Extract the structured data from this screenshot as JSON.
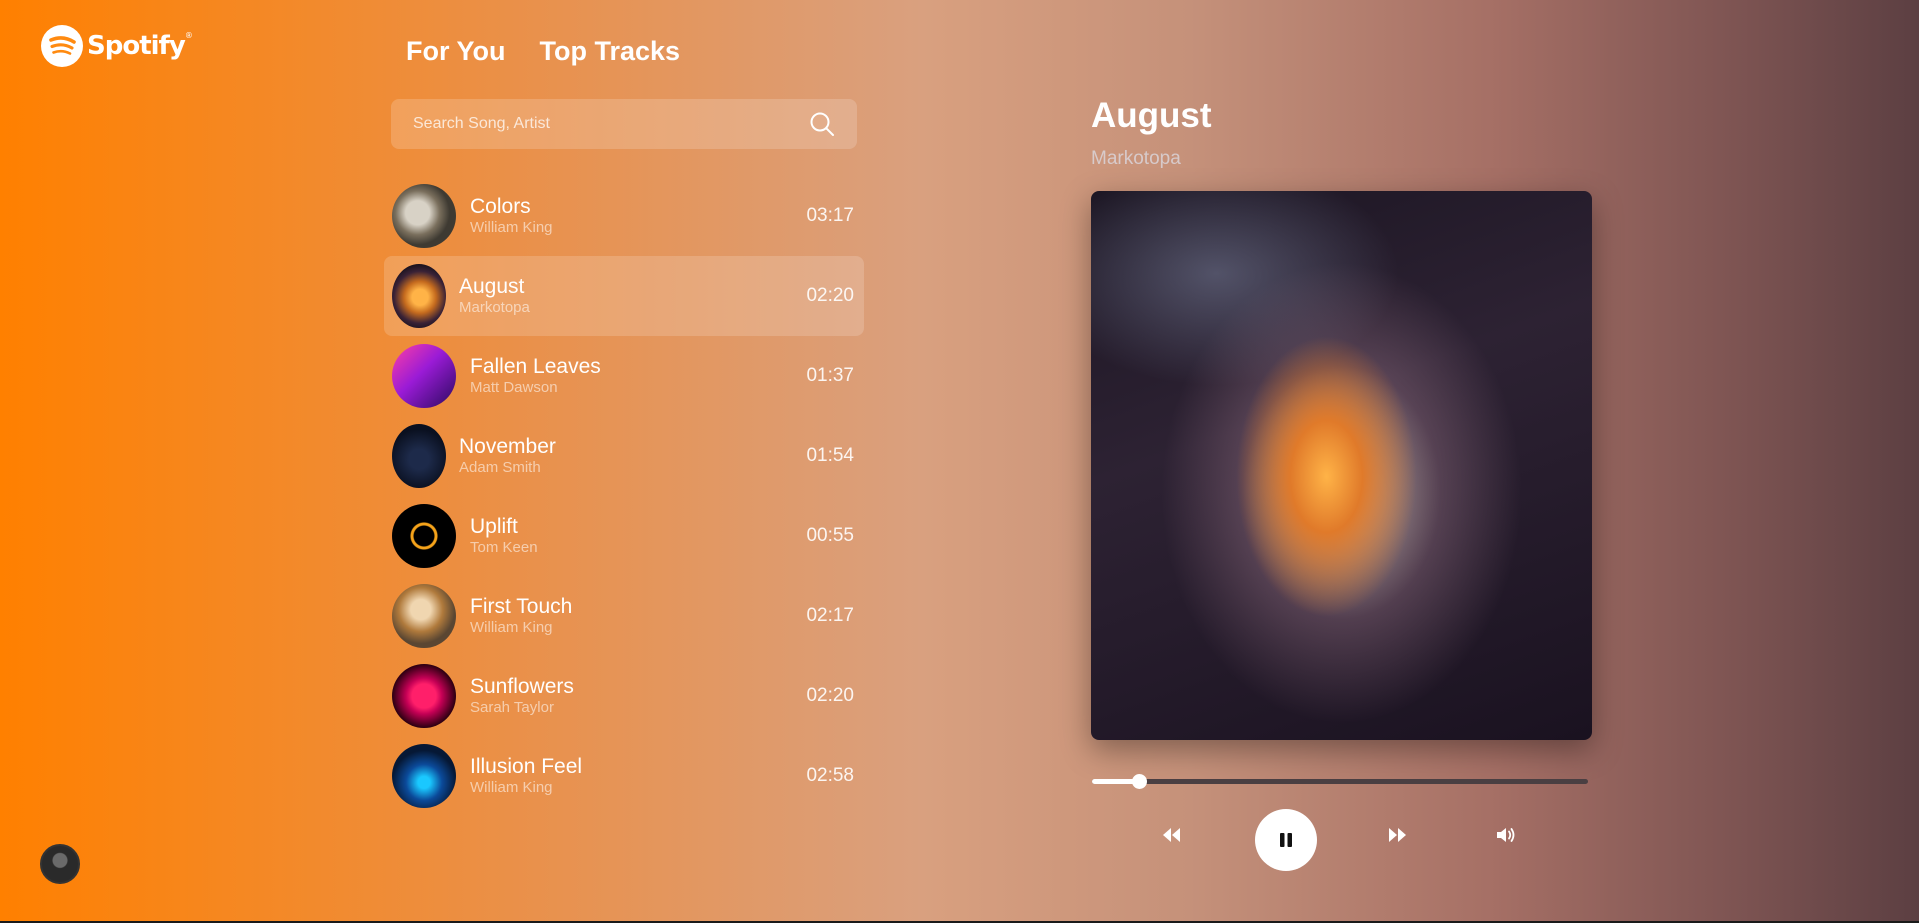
{
  "brand": {
    "name": "Spotify",
    "mark": "®"
  },
  "tabs": [
    {
      "label": "For You"
    },
    {
      "label": "Top Tracks"
    }
  ],
  "search": {
    "placeholder": "Search Song, Artist"
  },
  "tracks": [
    {
      "title": "Colors",
      "artist": "William King",
      "duration": "03:17"
    },
    {
      "title": "August",
      "artist": "Markotopa",
      "duration": "02:20",
      "active": true
    },
    {
      "title": "Fallen Leaves",
      "artist": "Matt Dawson",
      "duration": "01:37"
    },
    {
      "title": "November",
      "artist": "Adam Smith",
      "duration": "01:54"
    },
    {
      "title": "Uplift",
      "artist": "Tom Keen",
      "duration": "00:55"
    },
    {
      "title": "First Touch",
      "artist": "William King",
      "duration": "02:17"
    },
    {
      "title": "Sunflowers",
      "artist": "Sarah Taylor",
      "duration": "02:20"
    },
    {
      "title": "Illusion Feel",
      "artist": "William King",
      "duration": "02:58"
    }
  ],
  "now_playing": {
    "title": "August",
    "artist": "Markotopa",
    "progress": 0.095
  },
  "controls": {
    "icons": [
      "rewind-icon",
      "pause-icon",
      "fast-forward-icon",
      "volume-icon"
    ]
  },
  "colors": {
    "gradient_start": "#ff8000",
    "gradient_end": "#5c3f42",
    "accent": "#ffffff"
  }
}
